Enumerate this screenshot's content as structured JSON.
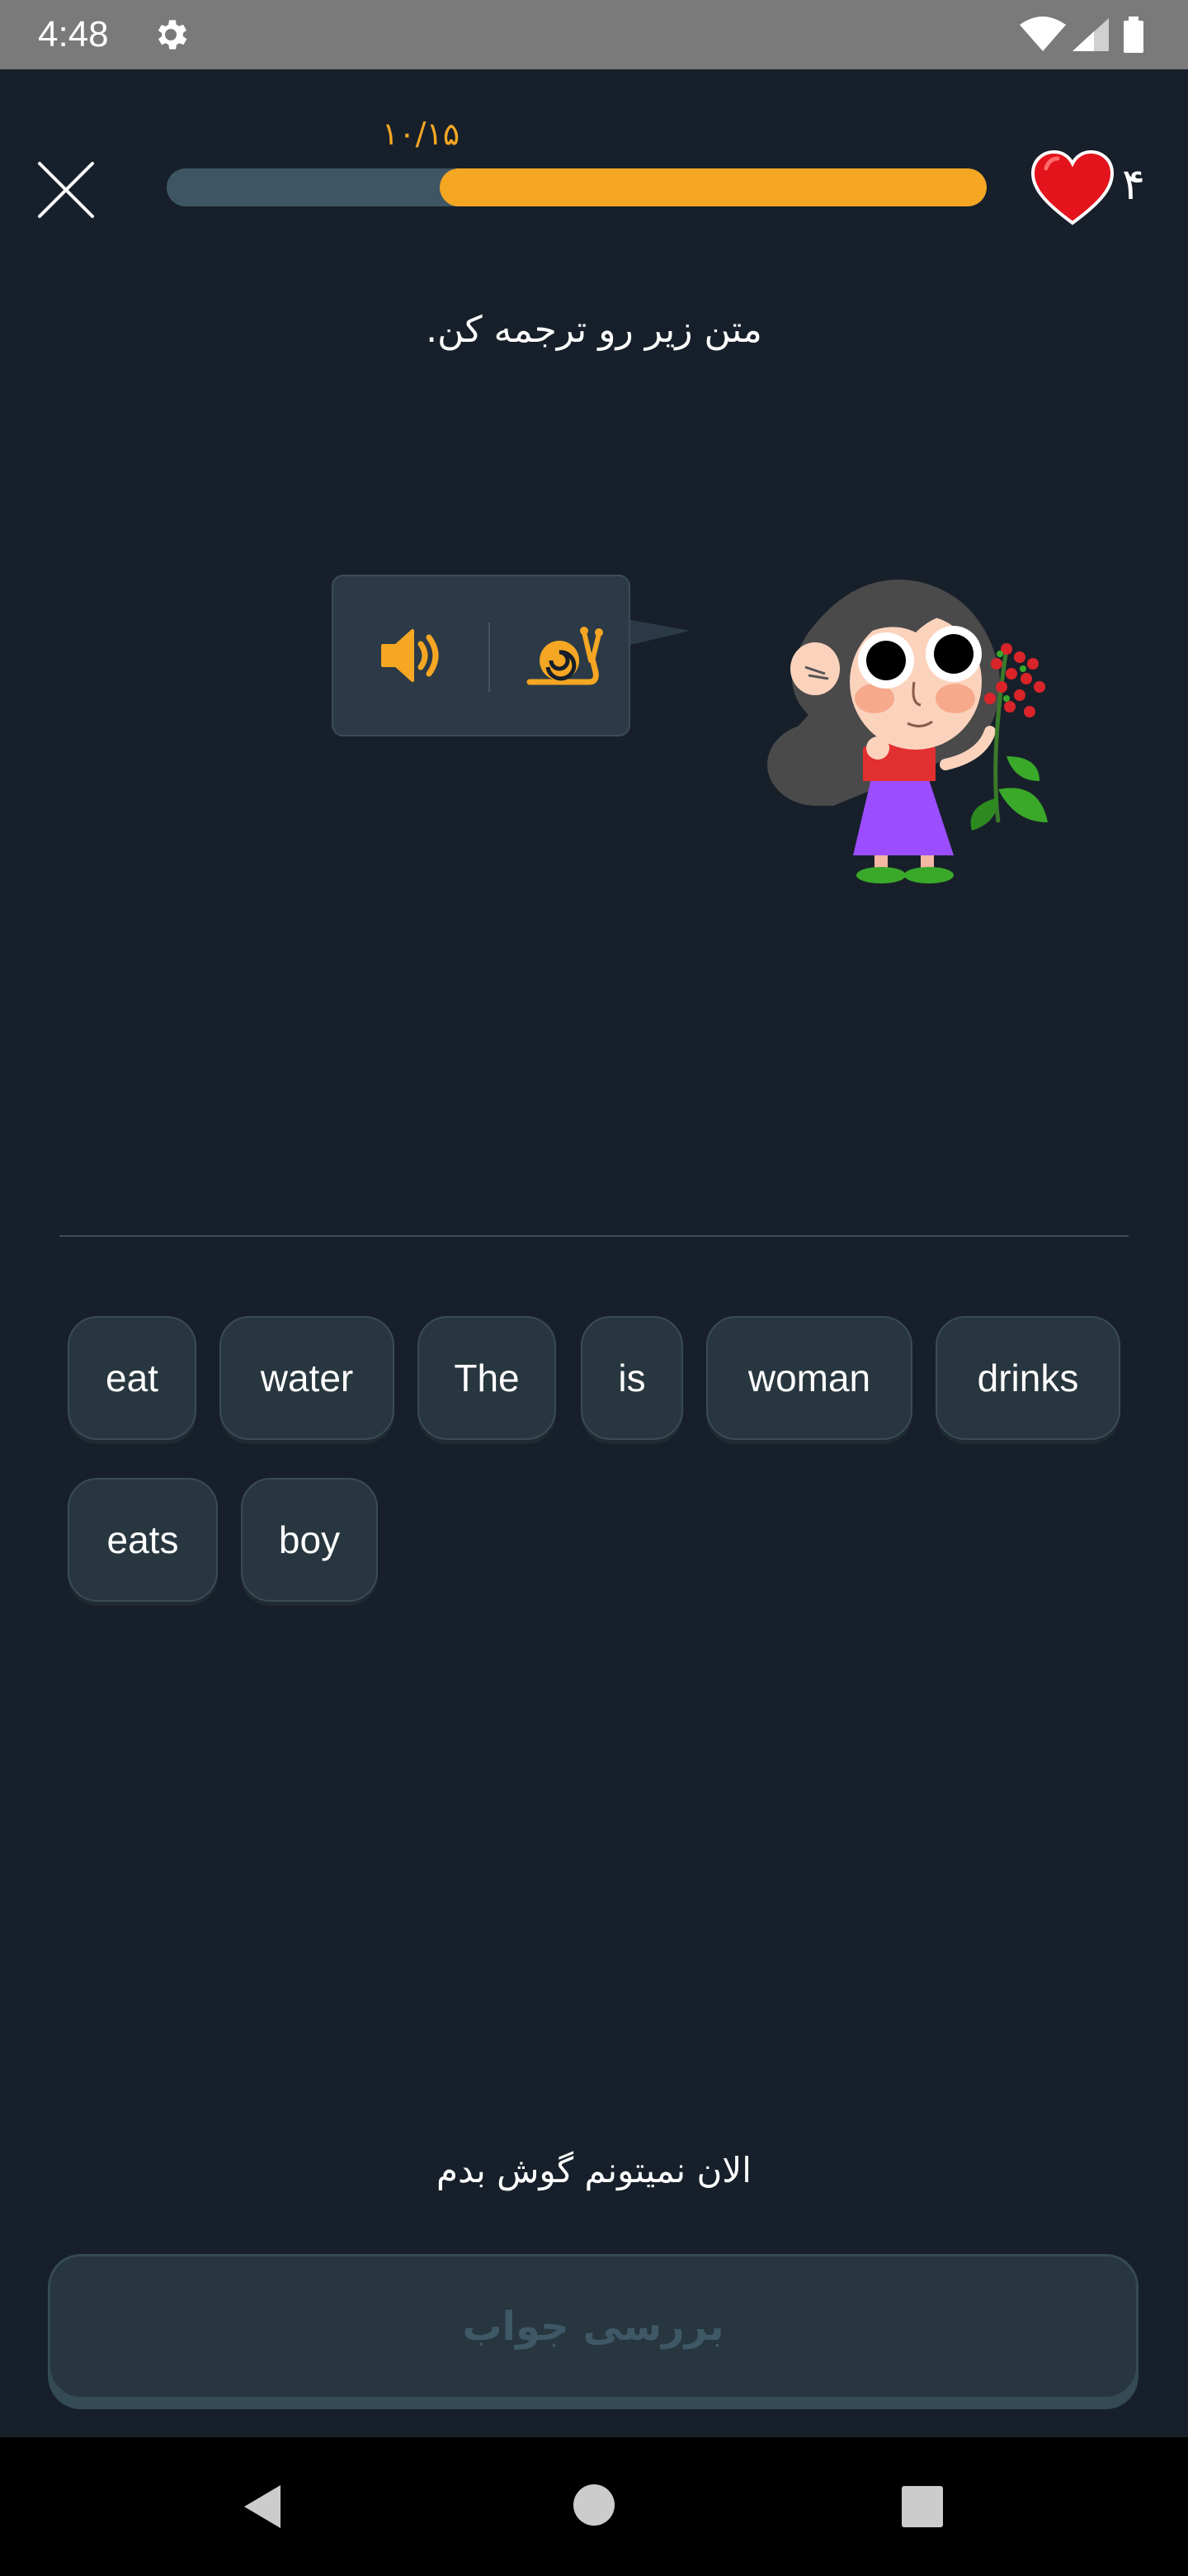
{
  "status_bar": {
    "time": "4:48",
    "icons": [
      "gear-icon",
      "wifi-icon",
      "signal-icon",
      "battery-icon"
    ]
  },
  "header": {
    "close_icon": "close-icon",
    "progress_label": "۱۰/۱۵",
    "progress_fraction": 0.667,
    "hearts_count": "۴",
    "heart_icon": "heart-icon"
  },
  "instruction": "متن زیر رو ترجمه کن.",
  "audio": {
    "normal_icon": "speaker-icon",
    "slow_icon": "snail-icon"
  },
  "word_bank": {
    "words": [
      "eat",
      "water",
      "The",
      "is",
      "woman",
      "drinks",
      "eats",
      "boy"
    ]
  },
  "cant_listen_label": "الان نمیتونم گوش بدم",
  "check_button_label": "بررسی جواب",
  "nav_bar": {
    "icons": [
      "back-icon",
      "home-icon",
      "recents-icon"
    ]
  },
  "colors": {
    "background": "#17202a",
    "accent": "#f5a623",
    "heart": "#e3141b",
    "chip_bg": "#28363f"
  }
}
